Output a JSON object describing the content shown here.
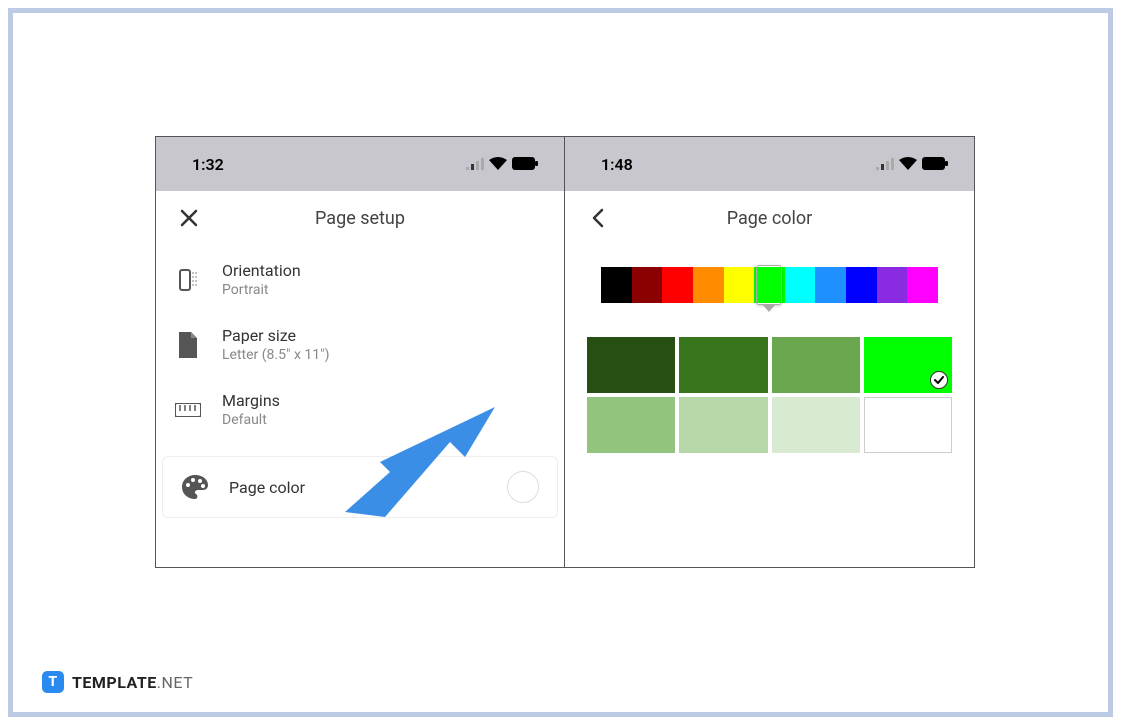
{
  "leftScreen": {
    "statusTime": "1:32",
    "panelTitle": "Page setup",
    "settings": {
      "orientation": {
        "label": "Orientation",
        "value": "Portrait"
      },
      "paperSize": {
        "label": "Paper size",
        "value": "Letter (8.5\" x 11\")"
      },
      "margins": {
        "label": "Margins",
        "value": "Default"
      },
      "pageColor": {
        "label": "Page color"
      }
    }
  },
  "rightScreen": {
    "statusTime": "1:48",
    "panelTitle": "Page color",
    "hueColors": [
      "#000000",
      "#8b0000",
      "#ff0000",
      "#ff8c00",
      "#ffff00",
      "#00ff00",
      "#00ffff",
      "#1e90ff",
      "#0000ff",
      "#8a2be2",
      "#ff00ff"
    ],
    "selectedHueIndex": 5,
    "shades": [
      {
        "color": "#274e13",
        "selected": false
      },
      {
        "color": "#38761d",
        "selected": false
      },
      {
        "color": "#6aa84f",
        "selected": false
      },
      {
        "color": "#00ff00",
        "selected": true
      },
      {
        "color": "#93c47d",
        "selected": false
      },
      {
        "color": "#b6d7a8",
        "selected": false
      },
      {
        "color": "#d9ead3",
        "selected": false
      },
      {
        "color": "#ffffff",
        "selected": false,
        "white": true
      }
    ]
  },
  "branding": {
    "t": "T",
    "word": "TEMPLATE",
    "suffix": ".NET"
  },
  "arrowColor": "#3b8ee6"
}
